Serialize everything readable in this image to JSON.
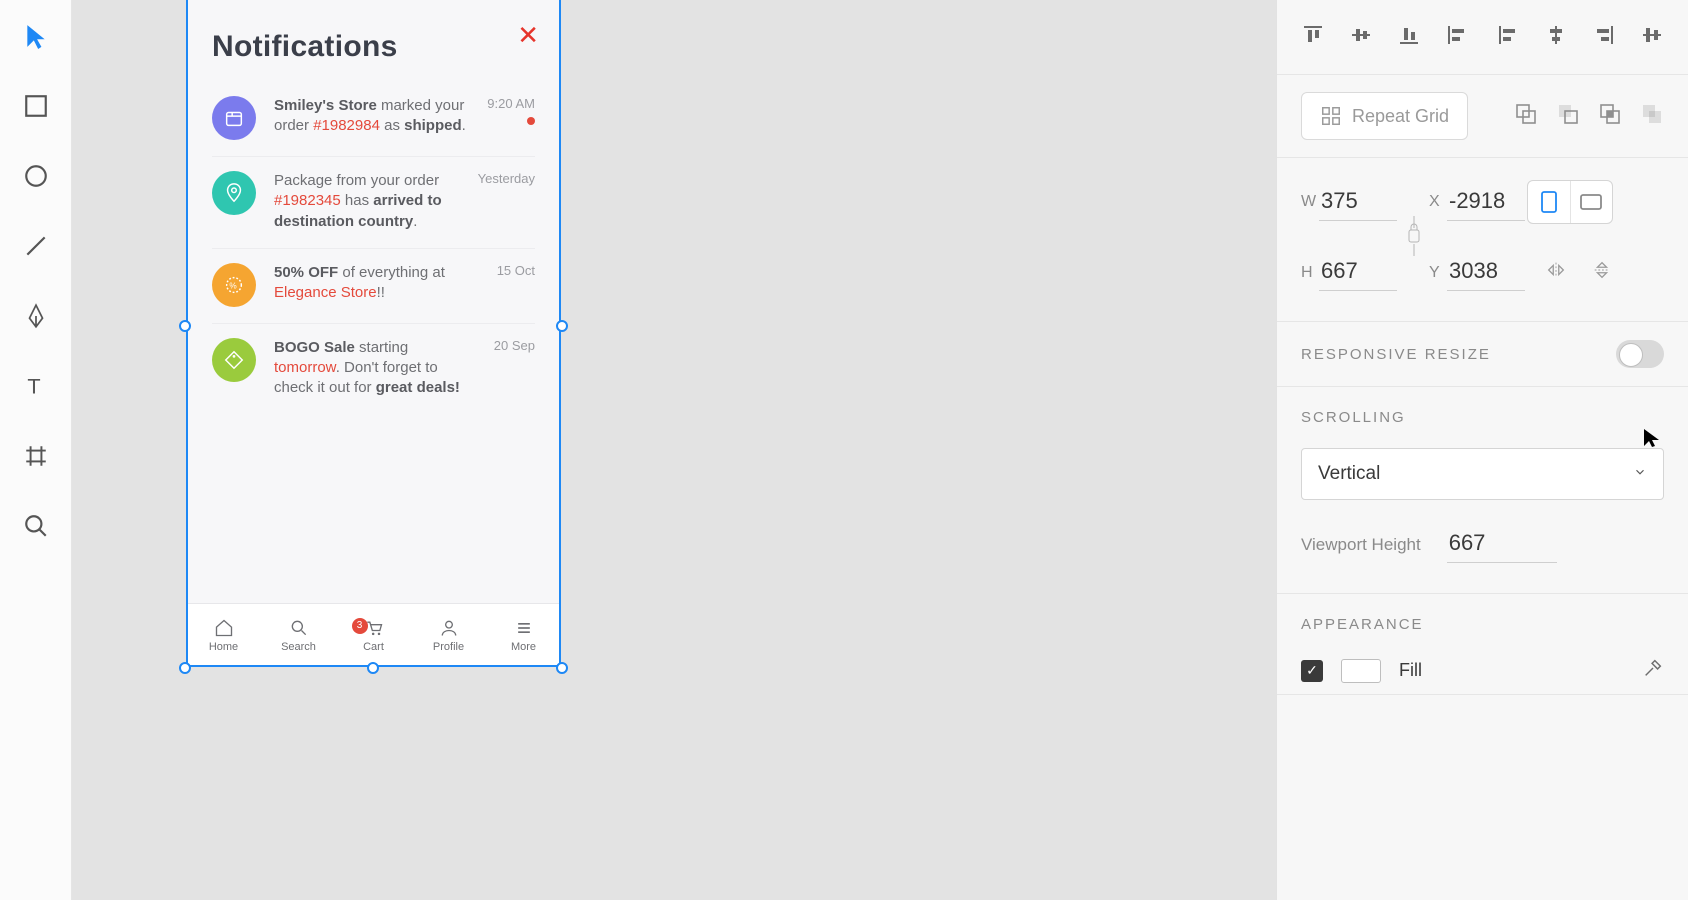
{
  "tools": [
    "select",
    "rectangle",
    "ellipse",
    "line",
    "pen",
    "text",
    "artboard",
    "zoom"
  ],
  "artboard": {
    "title": "Notifications",
    "notifications": [
      {
        "line1_a": "Smiley's Store",
        "line1_b": " marked your order ",
        "accent": "#1982984",
        "line2": " as ",
        "strong2": "shipped",
        "tail": ".",
        "time": "9:20 AM",
        "unread": true,
        "iconColor": "#7B7BED"
      },
      {
        "line1_a": "",
        "line1_b": "Package from your order ",
        "accent": "#1982345",
        "line2": " has ",
        "strong2": "arrived to destination country",
        "tail": ".",
        "time": "Yesterday",
        "unread": false,
        "iconColor": "#2FC6B0"
      },
      {
        "line1_a": "50% OFF",
        "line1_b": " of everything at ",
        "accent": "Elegance Store",
        "line2": "",
        "strong2": "",
        "tail": "!!",
        "time": "15 Oct",
        "unread": false,
        "iconColor": "#F5A531"
      },
      {
        "line1_a": "BOGO Sale",
        "line1_b": " starting ",
        "accent": "tomorrow",
        "line2": ". Don't forget to check it out for ",
        "strong2": "great deals!",
        "tail": "",
        "time": "20 Sep",
        "unread": false,
        "iconColor": "#9ACB3D"
      }
    ],
    "tabs": [
      {
        "label": "Home"
      },
      {
        "label": "Search"
      },
      {
        "label": "Cart",
        "badge": "3"
      },
      {
        "label": "Profile"
      },
      {
        "label": "More"
      }
    ]
  },
  "inspector": {
    "repeat_grid": "Repeat Grid",
    "dims": {
      "W": "375",
      "H": "667",
      "X": "-2918",
      "Y": "3038"
    },
    "responsive_resize": "RESPONSIVE RESIZE",
    "scrolling": "SCROLLING",
    "scroll_value": "Vertical",
    "viewport_label": "Viewport Height",
    "viewport_value": "667",
    "appearance": "APPEARANCE",
    "fill": "Fill"
  }
}
